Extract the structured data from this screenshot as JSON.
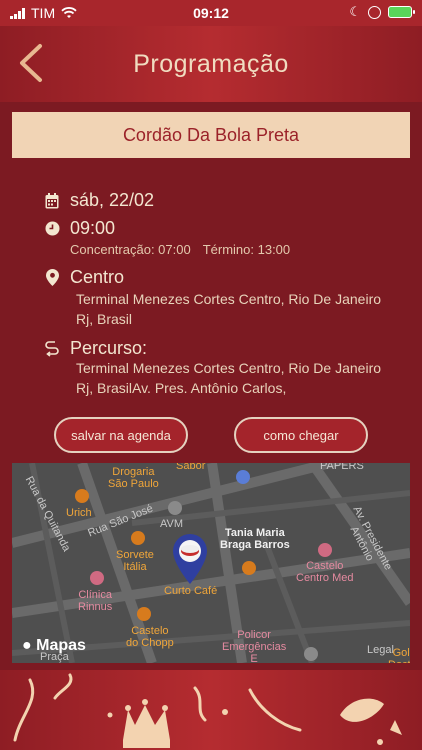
{
  "status_bar": {
    "carrier": "TIM",
    "time": "09:12"
  },
  "header": {
    "title": "Programação"
  },
  "event": {
    "name": "Cordão Da Bola Preta"
  },
  "info": {
    "date": "sáb, 22/02",
    "time": "09:00",
    "concentration": "Concentração: 07:00",
    "end": "Término: 13:00",
    "location_title": "Centro",
    "location_address": "Terminal Menezes Cortes   Centro, Rio De Janeiro   Rj, Brasil",
    "route_title": "Percurso:",
    "route_address": "Terminal Menezes Cortes   Centro, Rio De Janeiro   Rj, BrasilAv. Pres. Antônio Carlos,"
  },
  "buttons": {
    "save": "salvar na agenda",
    "directions": "como chegar"
  },
  "map": {
    "labels": {
      "drogaria": "Drogaria\nSão Paulo",
      "sabor": "Sabor",
      "papers": "PAPERS",
      "rua_quitanda": "Rua da Quitanda",
      "urich": "Urich",
      "rua_sao_jose": "Rua São José",
      "avm": "AVM",
      "tania": "Tania Maria\nBraga Barros",
      "av_pres": "Av. Presidente Antônio",
      "sorvete": "Sorvete\nItália",
      "castelo_med": "Castelo\nCentro Med",
      "clinica": "Clínica\nRinnus",
      "curto": "Curto Café",
      "castelo_chopp": "Castelo\ndo Chopp",
      "policor": "Policor\nEmergências\nE",
      "legal": "Legal",
      "praca": "Praça",
      "gold": "Gold\nDoctor"
    },
    "attribution": "Mapas"
  },
  "colors": {
    "primary": "#7c1a22",
    "header": "#b52c30",
    "banner": "#f1d4b5",
    "banner_text": "#9b2229",
    "button": "#a4242b"
  }
}
